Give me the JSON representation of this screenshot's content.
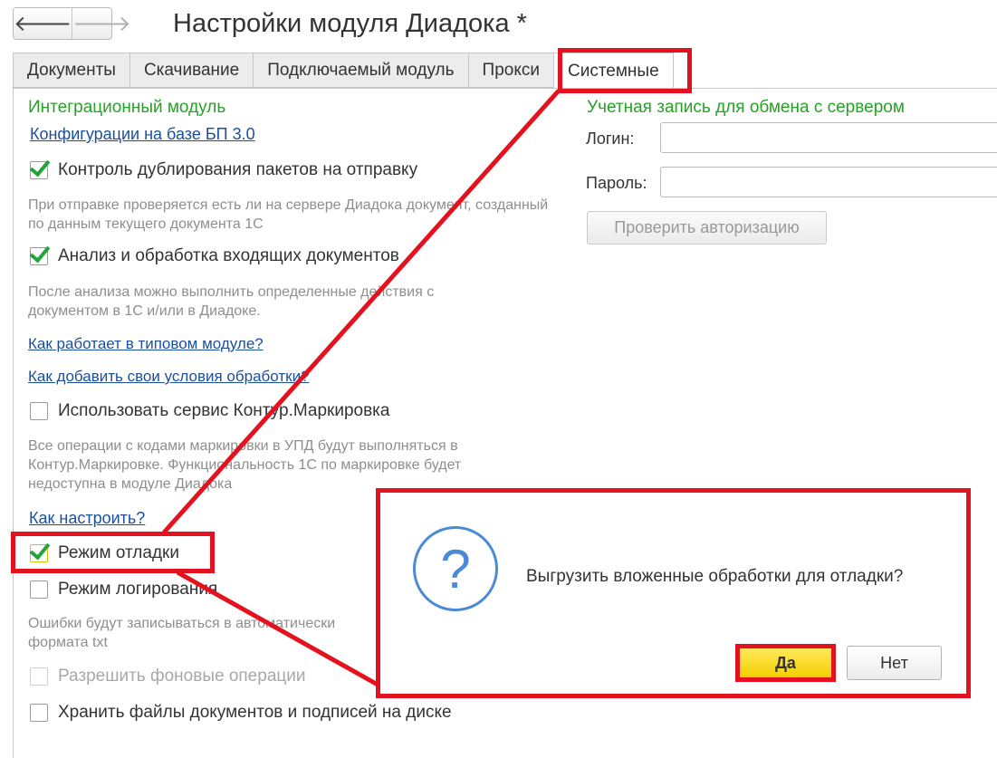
{
  "window": {
    "title": "Настройки модуля Диадока *",
    "nav_back_icon": "arrow-left-icon",
    "nav_forward_icon": "arrow-right-icon",
    "back_glyph": "🡐",
    "forward_glyph": "🡒"
  },
  "tabs": [
    {
      "label": "Документы"
    },
    {
      "label": "Скачивание"
    },
    {
      "label": "Подключаемый модуль"
    },
    {
      "label": "Прокси"
    },
    {
      "label": "Системные",
      "active": true
    }
  ],
  "left": {
    "section_title": "Интеграционный модуль",
    "config_link": "Конфигурации на базе БП 3.0",
    "dup_control": {
      "label": "Контроль дублирования пакетов на отправку",
      "checked": true
    },
    "dup_hint": "При отправке проверяется есть ли на сервере Диадока документ, созданный по данным текущего документа 1С",
    "incoming": {
      "label": "Анализ и обработка входящих документов",
      "checked": true
    },
    "incoming_hint": "После анализа можно выполнить определенные действия с документом в 1С и/или в Диадоке.",
    "link_how_works": "Как работает в типовом модуле?",
    "link_add_conditions": "Как добавить свои условия обработки?",
    "marking": {
      "label": "Использовать сервис Контур.Маркировка",
      "checked": false
    },
    "marking_hint": "Все операции с кодами маркировки в УПД будут выполняться в Контур.Маркировке. Функциональность 1С по маркировке будет недоступна в модуле Диадока",
    "link_how_setup": "Как настроить?",
    "debug": {
      "label": "Режим отладки",
      "checked": true
    },
    "logging": {
      "label": "Режим логирования",
      "checked": false
    },
    "logging_hint": "Ошибки будут записываться в автоматически формата txt",
    "background": {
      "label": "Разрешить фоновые операции",
      "checked": false,
      "disabled": true
    },
    "store_files": {
      "label": "Хранить файлы документов и подписей на диске",
      "checked": false
    }
  },
  "right": {
    "section_title": "Учетная запись для обмена с сервером",
    "login_label": "Логин:",
    "login_value": "",
    "password_label": "Пароль:",
    "password_value": "",
    "check_auth_button": "Проверить авторизацию"
  },
  "dialog": {
    "icon": "question-icon",
    "icon_glyph": "?",
    "message": "Выгрузить вложенные обработки для отладки?",
    "yes_label": "Да",
    "no_label": "Нет"
  },
  "colors": {
    "highlight": "#e3121e",
    "section_green": "#27a127",
    "link_blue": "#1b4f9c",
    "checkmark_green": "#21a33a",
    "yes_button": "#f2cf00",
    "question_blue": "#4b8ad6"
  }
}
